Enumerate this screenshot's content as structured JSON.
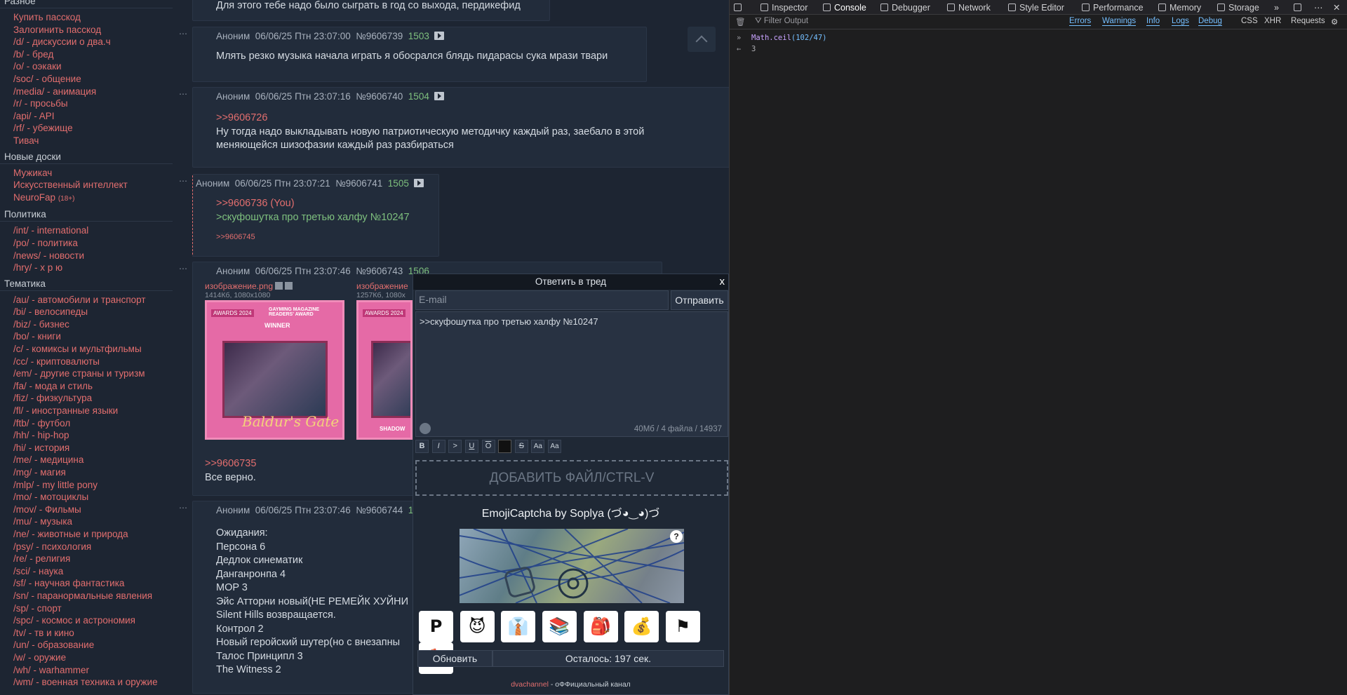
{
  "sidebar": {
    "sections": [
      {
        "title": "Разное",
        "items": [
          {
            "label": "Купить пасскод"
          },
          {
            "label": "Залогинить пасскод"
          },
          {
            "label": "/d/ - дискуссии о два.ч"
          },
          {
            "label": "/b/ - бред"
          },
          {
            "label": "/o/ - оэкаки"
          },
          {
            "label": "/soc/ - общение"
          },
          {
            "label": "/media/ - анимация"
          },
          {
            "label": "/r/ - просьбы"
          },
          {
            "label": "/api/ - API"
          },
          {
            "label": "/rf/ - убежище"
          },
          {
            "label": "Тивач"
          }
        ]
      },
      {
        "title": "Новые доски",
        "items": [
          {
            "label": "Мужикач"
          },
          {
            "label": "Искусственный интеллект"
          },
          {
            "label": "NeuroFap",
            "tag": "(18+)"
          }
        ]
      },
      {
        "title": "Политика",
        "items": [
          {
            "label": "/int/ - international"
          },
          {
            "label": "/po/ - политика"
          },
          {
            "label": "/news/ - новости"
          },
          {
            "label": "/hry/ - х р ю"
          }
        ]
      },
      {
        "title": "Тематика",
        "items": [
          {
            "label": "/au/ - автомобили и транспорт"
          },
          {
            "label": "/bi/ - велосипеды"
          },
          {
            "label": "/biz/ - бизнес"
          },
          {
            "label": "/bo/ - книги"
          },
          {
            "label": "/c/ - комиксы и мультфильмы"
          },
          {
            "label": "/cc/ - криптовалюты"
          },
          {
            "label": "/em/ - другие страны и туризм"
          },
          {
            "label": "/fa/ - мода и стиль"
          },
          {
            "label": "/fiz/ - физкультура"
          },
          {
            "label": "/fl/ - иностранные языки"
          },
          {
            "label": "/ftb/ - футбол"
          },
          {
            "label": "/hh/ - hip-hop"
          },
          {
            "label": "/hi/ - история"
          },
          {
            "label": "/me/ - медицина"
          },
          {
            "label": "/mg/ - магия"
          },
          {
            "label": "/mlp/ - my little pony"
          },
          {
            "label": "/mo/ - мотоциклы"
          },
          {
            "label": "/mov/ - Фильмы"
          },
          {
            "label": "/mu/ - музыка"
          },
          {
            "label": "/ne/ - животные и природа"
          },
          {
            "label": "/psy/ - психология"
          },
          {
            "label": "/re/ - религия"
          },
          {
            "label": "/sci/ - наука"
          },
          {
            "label": "/sf/ - научная фантастика"
          },
          {
            "label": "/sn/ - паранормальные явления"
          },
          {
            "label": "/sp/ - спорт"
          },
          {
            "label": "/spc/ - космос и астрономия"
          },
          {
            "label": "/tv/ - тв и кино"
          },
          {
            "label": "/un/ - образование"
          },
          {
            "label": "/w/ - оружие"
          },
          {
            "label": "/wh/ - warhammer"
          },
          {
            "label": "/wm/ - военная техника и оружие"
          }
        ]
      }
    ]
  },
  "thread": {
    "top_fragment": "Для этого тебе надо было сыграть в год со выхода, пердикефид",
    "posts": [
      {
        "author": "Аноним",
        "date": "06/06/25 Птн 23:07:00",
        "id": "№9606739",
        "num": "1503",
        "lines": [
          "Млять резко музыка начала играть я обосрался блядь пидарасы сука мрази твари"
        ]
      },
      {
        "author": "Аноним",
        "date": "06/06/25 Птн 23:07:16",
        "id": "№9606740",
        "num": "1504",
        "reply": ">>9606726",
        "lines": [
          "Ну тогда надо выкладывать новую патриотическую методичку каждый раз, заебало в этой",
          "меняющейся шизофазии каждый раз разбираться"
        ]
      },
      {
        "author": "Аноним",
        "date": "06/06/25 Птн 23:07:21",
        "id": "№9606741",
        "num": "1505",
        "reply": ">>9606736 (You)",
        "quote": ">скуфошутка про третью халфу №10247",
        "backlink": ">>9606745"
      },
      {
        "author": "Аноним",
        "date": "06/06/25 Птн 23:07:46",
        "id": "№9606743",
        "num": "1506",
        "files": [
          {
            "name": "изображение.png",
            "meta": "1414Кб, 1080x1080",
            "poster_badge": "AWARDS 2024",
            "poster_mag": "GAYMING MAGAZINE READERS' AWARD",
            "poster_winner": "WINNER",
            "poster_title": "Baldur's Gate"
          },
          {
            "name": "изображение",
            "meta": "1257Кб, 1080x",
            "poster_badge": "AWARDS 2024",
            "poster_title": "SHADOW"
          }
        ],
        "reply": ">>9606735",
        "lines": [
          "Все верно."
        ]
      },
      {
        "author": "Аноним",
        "date": "06/06/25 Птн 23:07:46",
        "id": "№9606744",
        "num": "1507",
        "lines": [
          "Ожидания:",
          "Персона 6",
          "Дедлок синематик",
          "Данганронпа 4",
          "MOP 3",
          "Эйс Атторни новый(НЕ РЕМЕЙК ХУЙНИ",
          "Silent Hills возвращается.",
          "Контрол 2",
          "Новый геройский шутер(но с внезапны",
          "Талос Принципл 3",
          "The Witness 2"
        ]
      }
    ]
  },
  "reply_form": {
    "title": "Ответить в тред",
    "close": "x",
    "email_placeholder": "E-mail",
    "send": "Отправить",
    "message": ">>скуфошутка про третью халфу №10247",
    "counter": "40Мб / 4 файла / 14937",
    "toolbar": [
      "B",
      "I",
      ">",
      "U",
      "O",
      "",
      "S",
      "Aa",
      "Aa"
    ],
    "add_file": "ДОБАВИТЬ ФАЙЛ/CTRL-V",
    "captcha_title": "EmojiCaptcha by Soplya (づ◕‿◕)づ",
    "captcha_help": "?",
    "emoji": [
      {
        "icon": "parking-icon",
        "glyph": "P"
      },
      {
        "icon": "devil-icon",
        "glyph": "😈"
      },
      {
        "icon": "suit-icon",
        "glyph": "👔"
      },
      {
        "icon": "books-icon",
        "glyph": "📚"
      },
      {
        "icon": "backpack-icon",
        "glyph": "🎒"
      },
      {
        "icon": "money-bag-icon",
        "glyph": "💰"
      },
      {
        "icon": "flag-icon",
        "glyph": "⚑"
      },
      {
        "icon": "axe-icon",
        "glyph": "🪓"
      }
    ],
    "refresh": "Обновить",
    "remaining": "Осталось: 197 сек.",
    "channel_link": "dvachannel",
    "channel_text": " - оФФициальный канал"
  },
  "devtools": {
    "tabs": [
      "Inspector",
      "Console",
      "Debugger",
      "Network",
      "Style Editor",
      "Performance",
      "Memory",
      "Storage"
    ],
    "active_tab": "Console",
    "filter_placeholder": "Filter Output",
    "filters": [
      "Errors",
      "Warnings",
      "Info",
      "Logs",
      "Debug"
    ],
    "extra_filters": [
      "CSS",
      "XHR",
      "Requests"
    ],
    "console": {
      "input_fn": "Math.ceil",
      "input_args": "(102/47)",
      "result": "3"
    }
  },
  "colors": {
    "accent": "#e26e6e",
    "quote": "#7ec07e",
    "link_active": "#75bfff"
  }
}
